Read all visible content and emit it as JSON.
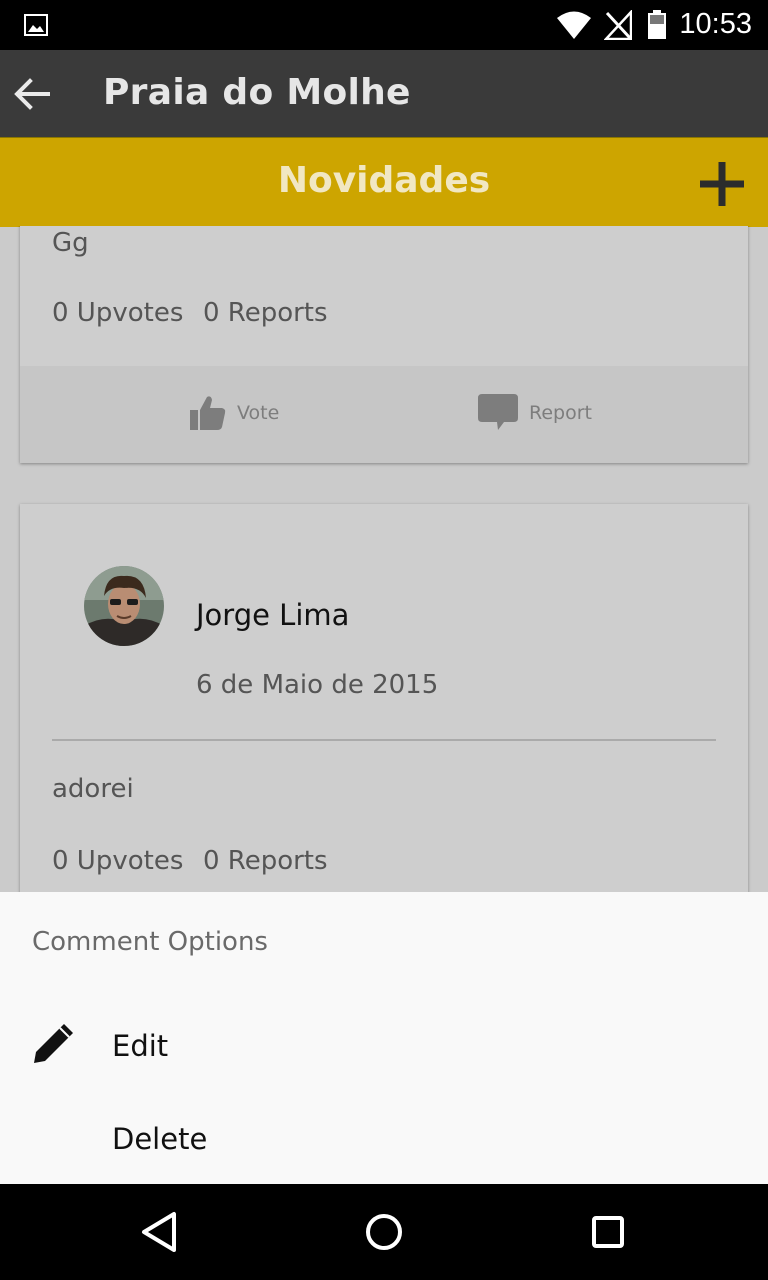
{
  "status_bar": {
    "time": "10:53",
    "icons": [
      "image-icon",
      "wifi-icon",
      "no-signal-icon",
      "battery-icon"
    ]
  },
  "app_bar": {
    "title": "Praia do Molhe",
    "back_icon": "arrow-left-icon"
  },
  "sub_bar": {
    "title": "Novidades",
    "add_icon": "plus-icon",
    "color": "#cda500"
  },
  "posts": [
    {
      "text": "Gg",
      "upvotes": "0 Upvotes",
      "reports": "0 Reports",
      "vote_label": "Vote",
      "report_label": "Report"
    },
    {
      "author": "Jorge Lima",
      "date": "6 de Maio de 2015",
      "text": "adorei",
      "upvotes": "0 Upvotes",
      "reports": "0 Reports"
    }
  ],
  "comment_options": {
    "heading": "Comment Options",
    "items": [
      {
        "label": "Edit",
        "icon": "pencil-icon"
      },
      {
        "label": "Delete"
      }
    ]
  },
  "nav_bar": {
    "buttons": [
      "back-triangle-icon",
      "home-circle-icon",
      "recents-square-icon"
    ]
  }
}
